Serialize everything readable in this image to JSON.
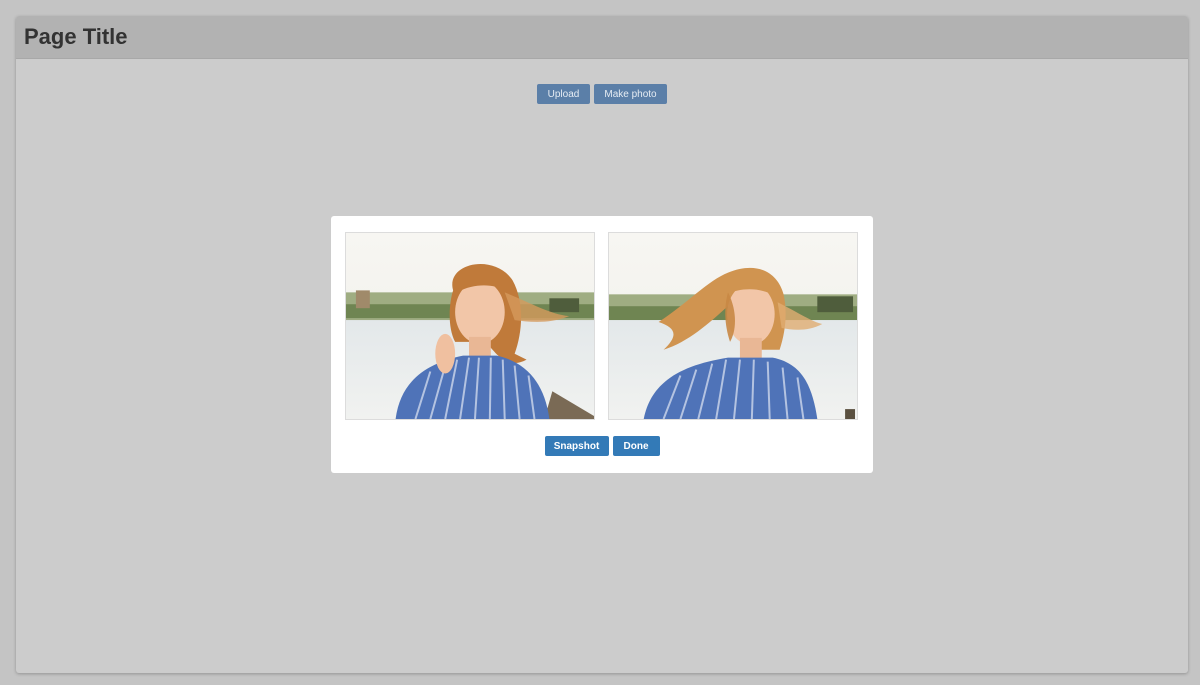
{
  "header": {
    "title": "Page Title"
  },
  "toolbar": {
    "upload_label": "Upload",
    "make_photo_label": "Make photo"
  },
  "modal": {
    "photos": [
      {
        "subject": "woman-striped-shirt-hand-in-hair"
      },
      {
        "subject": "woman-striped-shirt-hair-blowing"
      }
    ],
    "snapshot_label": "Snapshot",
    "done_label": "Done"
  },
  "colors": {
    "page_background": "#c4c4c4",
    "frame_background": "#cccccc",
    "header_background": "#b2b2b2",
    "title_text": "#333333",
    "muted_button": "#5b7fa8",
    "primary_button": "#337ab7",
    "modal_background": "#ffffff"
  }
}
